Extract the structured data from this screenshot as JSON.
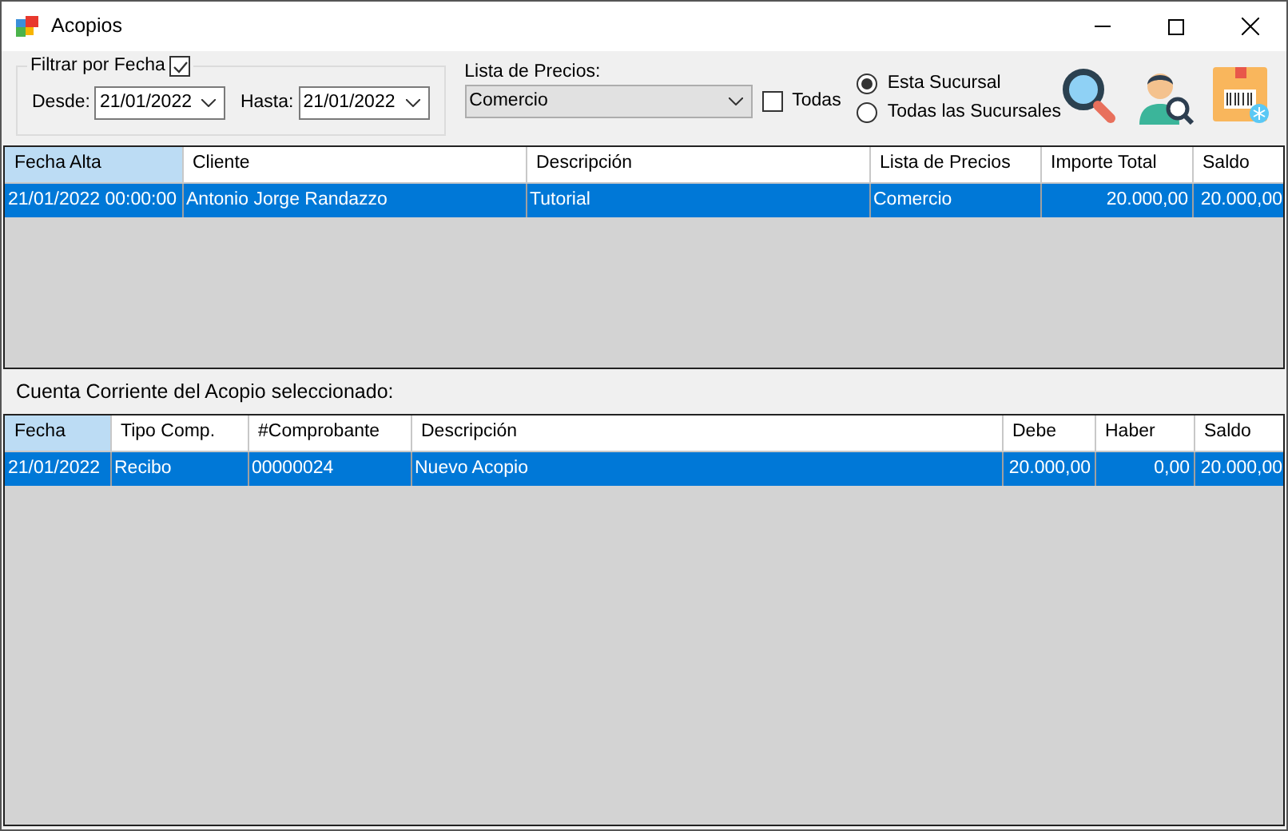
{
  "window": {
    "title": "Acopios"
  },
  "filter": {
    "legend": "Filtrar por Fecha",
    "checked": true,
    "from_label": "Desde:",
    "from": "21/01/2022",
    "to_label": "Hasta:",
    "to": "21/01/2022"
  },
  "price_list": {
    "label": "Lista de Precios:",
    "value": "Comercio",
    "all_label": "Todas",
    "all_checked": false
  },
  "branch": [
    {
      "label": "Esta Sucursal",
      "selected": true
    },
    {
      "label": "Todas las Sucursales",
      "selected": false
    }
  ],
  "acopios": {
    "columns": [
      {
        "label": "Fecha Alta",
        "selected": true
      },
      {
        "label": "Cliente",
        "selected": false
      },
      {
        "label": "Descripción",
        "selected": false
      },
      {
        "label": "Lista de Precios",
        "selected": false
      },
      {
        "label": "Importe Total",
        "selected": false
      },
      {
        "label": "Saldo",
        "selected": false
      }
    ],
    "rows": [
      {
        "selected": true,
        "cells": [
          "21/01/2022 00:00:00",
          "Antonio Jorge Randazzo",
          "Tutorial",
          "Comercio",
          "20.000,00",
          "20.000,00"
        ]
      }
    ]
  },
  "account_label": "Cuenta Corriente del Acopio seleccionado:",
  "account": {
    "columns": [
      {
        "label": "Fecha",
        "selected": true
      },
      {
        "label": "Tipo Comp.",
        "selected": false
      },
      {
        "label": "#Comprobante",
        "selected": false
      },
      {
        "label": "Descripción",
        "selected": false
      },
      {
        "label": "Debe",
        "selected": false
      },
      {
        "label": "Haber",
        "selected": false
      },
      {
        "label": "Saldo",
        "selected": false
      }
    ],
    "rows": [
      {
        "selected": true,
        "cells": [
          "21/01/2022",
          "Recibo",
          "00000024",
          "Nuevo Acopio",
          "20.000,00",
          "0,00",
          "20.000,00"
        ]
      }
    ]
  }
}
